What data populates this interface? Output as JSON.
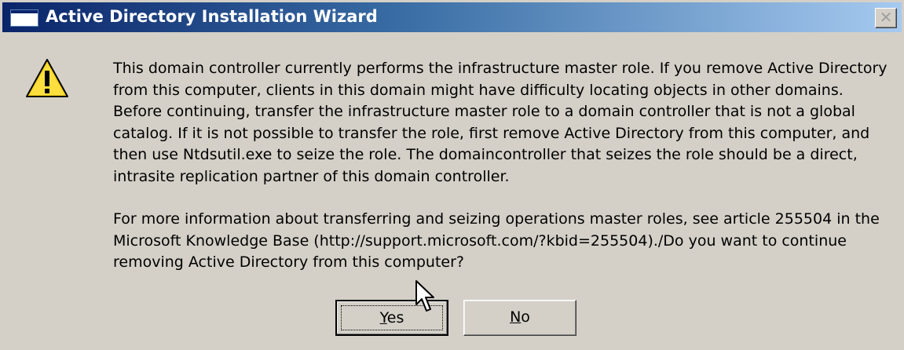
{
  "window": {
    "title": "Active Directory Installation Wizard",
    "close_glyph": "✕",
    "title_icon": "window-app-icon"
  },
  "dialog": {
    "icon": "warning-icon",
    "paragraph1": "This domain controller currently performs the infrastructure master role. If you remove Active Directory from this computer, clients in this domain might have difficulty locating objects in other domains. Before continuing, transfer the infrastructure master role to a domain controller that is not a global catalog. If it is not possible to transfer the role, first remove Active Directory from this computer, and then use Ntdsutil.exe to seize the role. The domaincontroller that seizes the role should be a direct, intrasite replication partner of this domain controller.",
    "paragraph2": "For more information about transferring and seizing operations master roles, see article 255504 in the Microsoft Knowledge Base (http://support.microsoft.com/?kbid=255504)./Do you want to continue removing Active Directory from this computer?"
  },
  "buttons": {
    "yes": {
      "label": "Yes",
      "mnemonic": "Y"
    },
    "no": {
      "label": "No",
      "mnemonic": "N"
    }
  },
  "colors": {
    "titlebar_start": "#0a246a",
    "titlebar_end": "#a6caf0",
    "dialog_bg": "#d4d0c8",
    "warning_yellow": "#f7d117"
  }
}
